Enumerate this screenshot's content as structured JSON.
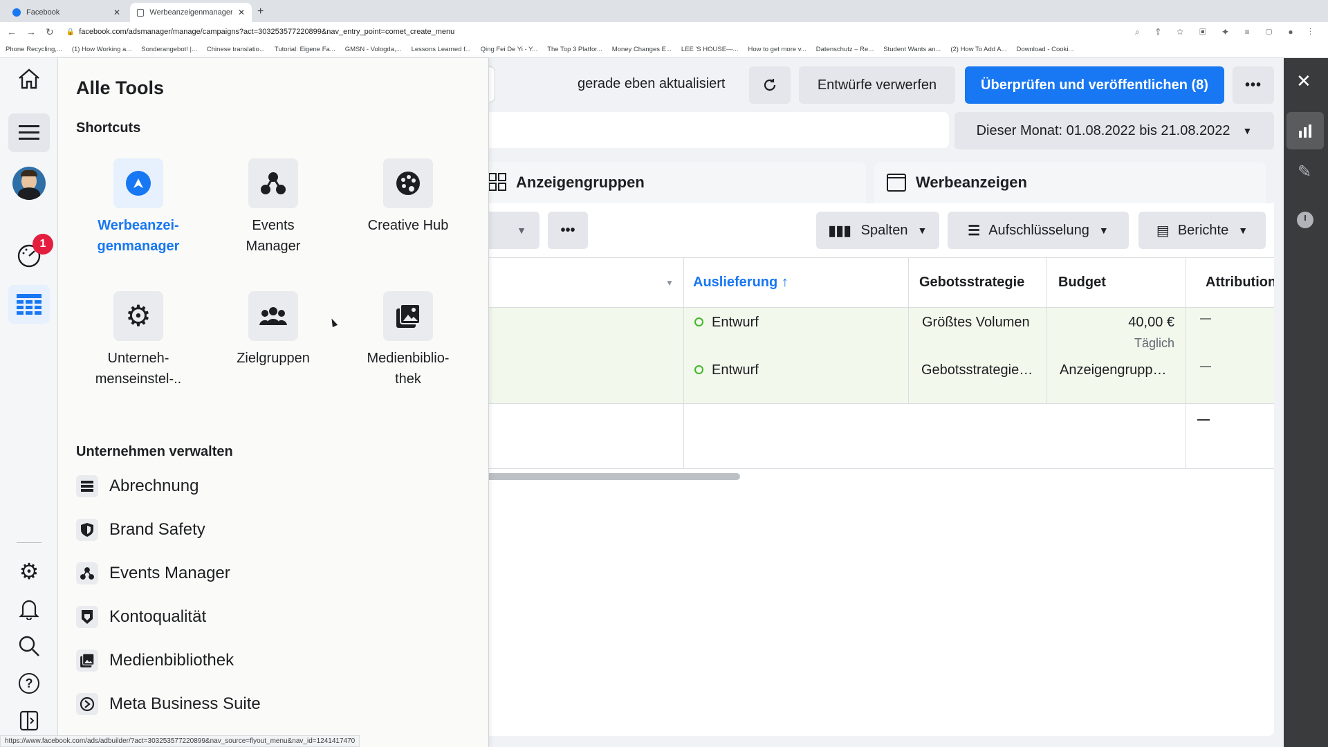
{
  "browser": {
    "tabs": [
      {
        "title": "Facebook"
      },
      {
        "title": "Werbeanzeigenmanager - We"
      }
    ],
    "url": "facebook.com/adsmanager/manage/campaigns?act=303253577220899&nav_entry_point=comet_create_menu",
    "bookmarks": [
      "Phone Recycling,...",
      "(1) How Working a...",
      "Sonderangebot! |...",
      "Chinese translatio...",
      "Tutorial: Eigene Fa...",
      "GMSN - Vologda,...",
      "Lessons Learned f...",
      "Qing Fei De Yi - Y...",
      "The Top 3 Platfor...",
      "Money Changes E...",
      "LEE 'S HOUSE—...",
      "How to get more v...",
      "Datenschutz – Re...",
      "Student Wants an...",
      "(2) How To Add A...",
      "Download - Cooki..."
    ],
    "status_url": "https://www.facebook.com/ads/adbuilder/?act=303253577220899&nav_source=flyout_menu&nav_id=1241417470"
  },
  "leftnav": {
    "notification_count": "1"
  },
  "tools": {
    "title": "Alle Tools",
    "shortcuts_heading": "Shortcuts",
    "shortcuts": [
      {
        "label": "Werbeanzei-genmanager",
        "line1": "Werbeanzei-",
        "line2": "genmanager",
        "icon": "ads-manager-icon"
      },
      {
        "label": "Events Manager",
        "line1": "Events",
        "line2": "Manager",
        "icon": "events-icon"
      },
      {
        "label": "Creative Hub",
        "line1": "Creative Hub",
        "line2": "",
        "icon": "palette-icon"
      },
      {
        "label": "Unterneh-menseinstel-..",
        "line1": "Unterneh-",
        "line2": "menseinstel-..",
        "icon": "gear-icon"
      },
      {
        "label": "Zielgruppen",
        "line1": "Zielgruppen",
        "line2": "",
        "icon": "people-icon"
      },
      {
        "label": "Medienbiblio-thek",
        "line1": "Medienbiblio-",
        "line2": "thek",
        "icon": "media-icon"
      }
    ],
    "manage_heading": "Unternehmen verwalten",
    "manage_items": [
      "Abrechnung",
      "Brand Safety",
      "Events Manager",
      "Kontoqualität",
      "Medienbibliothek",
      "Meta Business Suite"
    ]
  },
  "toolbar": {
    "updated_text": "gerade eben aktualisiert",
    "discard_label": "Entwürfe verwerfen",
    "publish_label": "Überprüfen und veröffentlichen (8)",
    "date_range": "Dieser Monat: 01.08.2022 bis 21.08.2022"
  },
  "levels": {
    "adsets": "Anzeigengruppen",
    "ads": "Werbeanzeigen"
  },
  "actions": {
    "columns": "Spalten",
    "breakdown": "Aufschlüsselung",
    "reports": "Berichte"
  },
  "table": {
    "headers": {
      "delivery": "Auslieferung",
      "bid": "Gebotsstrategie",
      "budget": "Budget",
      "attribution": "Attribution"
    },
    "rows": [
      {
        "delivery": "Entwurf",
        "bid": "Größtes Volumen",
        "budget": "40,00 €",
        "budget_sub": "Täglich",
        "attribution": "—"
      },
      {
        "delivery": "Entwurf",
        "bid": "Gebotsstrategie…",
        "budget": "Anzeigengrupp…",
        "attribution": "—"
      }
    ],
    "total_attribution": "—"
  },
  "colors": {
    "accent": "#1877f2",
    "draft_green": "#42b72a",
    "row_highlight": "#f2f8ec"
  }
}
